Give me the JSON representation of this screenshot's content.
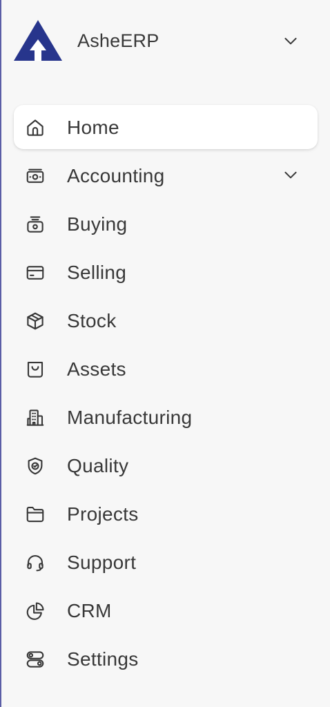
{
  "app": {
    "name": "AsheERP",
    "logo_icon": "ashe-erp-logo",
    "brand_color": "#27358c",
    "switch_icon": "chevron-down-icon"
  },
  "sidebar": {
    "items": [
      {
        "label": "Home",
        "icon": "home-icon",
        "active": true
      },
      {
        "label": "Accounting",
        "icon": "money-icon",
        "expandable": true
      },
      {
        "label": "Buying",
        "icon": "cash-register-icon"
      },
      {
        "label": "Selling",
        "icon": "credit-card-icon"
      },
      {
        "label": "Stock",
        "icon": "box-icon"
      },
      {
        "label": "Assets",
        "icon": "shopping-bag-icon"
      },
      {
        "label": "Manufacturing",
        "icon": "building-icon"
      },
      {
        "label": "Quality",
        "icon": "shield-check-icon"
      },
      {
        "label": "Projects",
        "icon": "folder-icon"
      },
      {
        "label": "Support",
        "icon": "headset-icon"
      },
      {
        "label": "CRM",
        "icon": "pie-chart-icon"
      },
      {
        "label": "Settings",
        "icon": "toggles-icon"
      }
    ]
  }
}
